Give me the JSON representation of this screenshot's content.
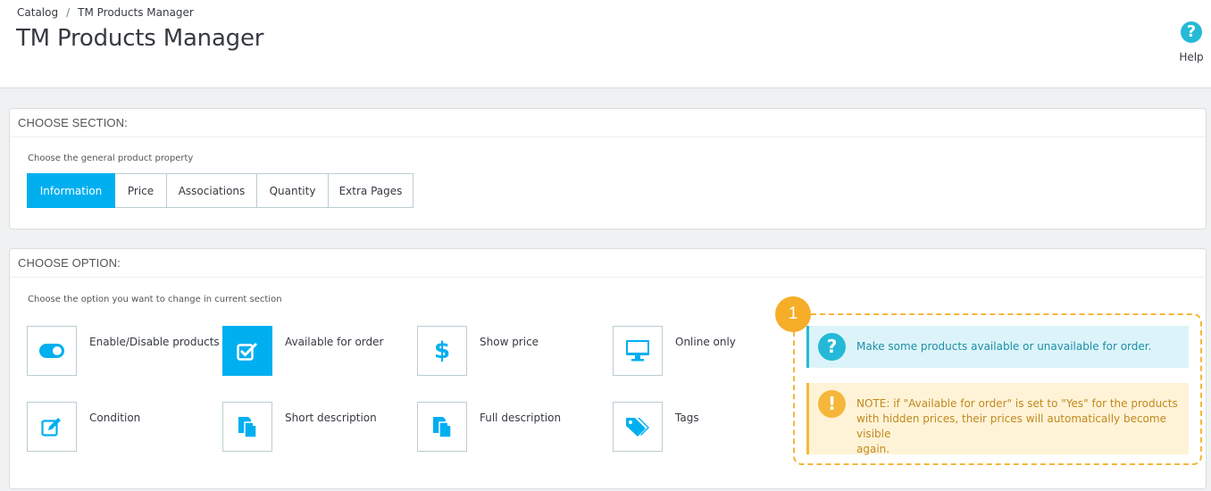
{
  "breadcrumb": {
    "parent": "Catalog",
    "separator": "/",
    "current": "TM Products Manager"
  },
  "page_title": "TM Products Manager",
  "help": {
    "label": "Help",
    "icon": "question-circle-icon"
  },
  "section_panel": {
    "heading": "CHOOSE SECTION:",
    "hint": "Choose the general product property",
    "tabs": [
      {
        "label": "Information",
        "active": true
      },
      {
        "label": "Price",
        "active": false
      },
      {
        "label": "Associations",
        "active": false
      },
      {
        "label": "Quantity",
        "active": false
      },
      {
        "label": "Extra Pages",
        "active": false
      }
    ]
  },
  "option_panel": {
    "heading": "CHOOSE OPTION:",
    "hint": "Choose the option you want to change in current section",
    "options": [
      {
        "label": "Enable/Disable products",
        "icon": "toggle-icon",
        "active": false
      },
      {
        "label": "Available for order",
        "icon": "checkbox-icon",
        "active": true
      },
      {
        "label": "Show price",
        "icon": "dollar-icon",
        "active": false
      },
      {
        "label": "Online only",
        "icon": "monitor-icon",
        "active": false
      },
      {
        "label": "Condition",
        "icon": "edit-icon",
        "active": false
      },
      {
        "label": "Short description",
        "icon": "document-icon",
        "active": false
      },
      {
        "label": "Full description",
        "icon": "document-icon",
        "active": false
      },
      {
        "label": "Tags",
        "icon": "tags-icon",
        "active": false
      }
    ]
  },
  "callout": {
    "number": "1",
    "info": "Make some products available or unavailable for order.",
    "warning_lines": [
      "NOTE: if \"Available for order\" is set to \"Yes\" for the products",
      "with hidden prices, their prices will automatically become visible",
      "again."
    ]
  },
  "colors": {
    "accent": "#00aff0",
    "info": "#25b9d7",
    "warning": "#f5b73a"
  }
}
